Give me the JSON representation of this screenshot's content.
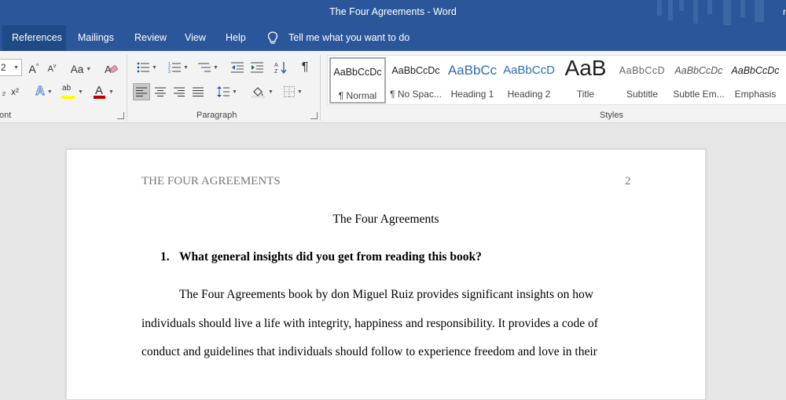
{
  "window": {
    "title": "The Four Agreements  -  Word",
    "edge_text": "r"
  },
  "tabs": [
    {
      "label": "References",
      "active": true
    },
    {
      "label": "Mailings"
    },
    {
      "label": "Review"
    },
    {
      "label": "View"
    },
    {
      "label": "Help"
    }
  ],
  "tell_me": {
    "label": "Tell me what you want to do",
    "icon": "lightbulb-icon"
  },
  "ribbon": {
    "font_group_label": "ont",
    "paragraph_group_label": "Paragraph",
    "styles_group_label": "Styles",
    "font_size_value": "2",
    "change_case": "Aa",
    "grow_font": "A",
    "shrink_font": "A",
    "superscript": "x²",
    "font_color_letter": "A",
    "highlight_text": "ab",
    "show_marks": "¶",
    "colors": {
      "font_color": "#c00000",
      "highlight": "#ffff00",
      "accent": "#2b579a"
    }
  },
  "styles": [
    {
      "preview": "AaBbCcDc",
      "label": "¶ Normal",
      "selected": true
    },
    {
      "preview": "AaBbCcDc",
      "label": "¶ No Spac..."
    },
    {
      "preview": "AaBbCc",
      "label": "Heading 1"
    },
    {
      "preview": "AaBbCcD",
      "label": "Heading 2"
    },
    {
      "preview": "AaB",
      "label": "Title"
    },
    {
      "preview": "AaBbCcD",
      "label": "Subtitle"
    },
    {
      "preview": "AaBbCcDc",
      "label": "Subtle Em..."
    },
    {
      "preview": "AaBbCcDc",
      "label": "Emphasis"
    }
  ],
  "document": {
    "running_head": "THE FOUR AGREEMENTS",
    "page_number": "2",
    "title": "The Four Agreements",
    "question_number": "1.",
    "question": "What general insights did you get from reading this book?",
    "lines": [
      "The Four Agreements book by don Miguel Ruiz provides significant insights on how",
      "individuals should live a life with integrity, happiness and responsibility. It provides a code of",
      "conduct and guidelines that individuals should follow to experience freedom and love in their"
    ]
  }
}
